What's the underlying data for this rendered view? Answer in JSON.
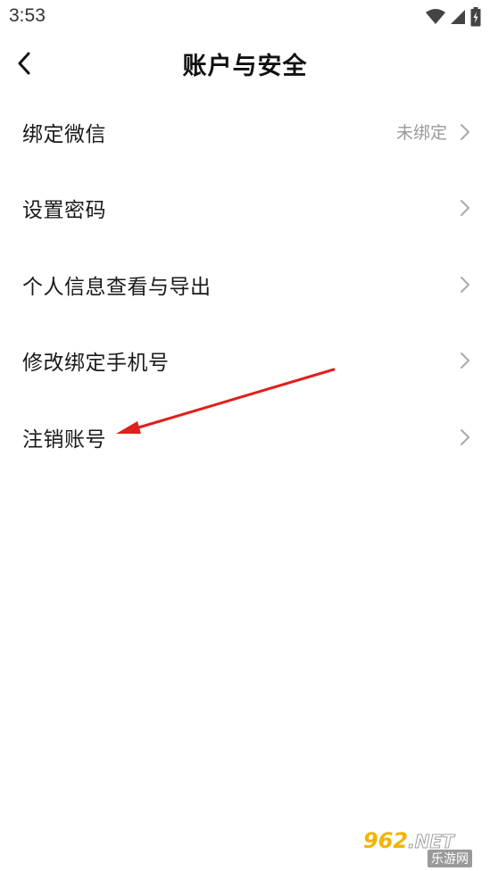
{
  "status_bar": {
    "time": "3:53",
    "icons": [
      "wifi-icon",
      "cellular-signal-icon",
      "battery-icon"
    ]
  },
  "header": {
    "title": "账户与安全",
    "back_icon": "chevron-left-icon"
  },
  "menu": {
    "items": [
      {
        "label": "绑定微信",
        "value": "未绑定"
      },
      {
        "label": "设置密码",
        "value": ""
      },
      {
        "label": "个人信息查看与导出",
        "value": ""
      },
      {
        "label": "修改绑定手机号",
        "value": ""
      },
      {
        "label": "注销账号",
        "value": ""
      }
    ]
  },
  "annotation": {
    "arrow_color": "#e0201c",
    "points_to": "注销账号"
  },
  "watermark": {
    "main": "962",
    "suffix": ".NET",
    "sub": "乐游网"
  },
  "colors": {
    "background": "#ffffff",
    "text_primary": "#1a1a1a",
    "text_secondary": "#999999",
    "chevron": "#aaaaaa"
  }
}
